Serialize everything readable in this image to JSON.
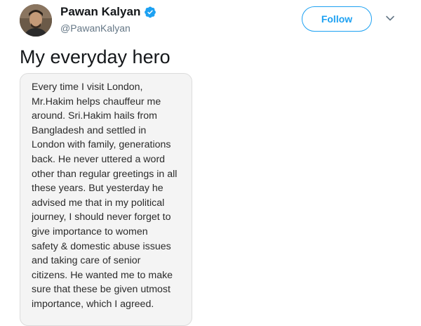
{
  "user": {
    "display_name": "Pawan Kalyan",
    "handle": "@PawanKalyan",
    "verified": true
  },
  "actions": {
    "follow_label": "Follow",
    "accent_color": "#1da1f2"
  },
  "icons": {
    "verified": "verified-badge-icon",
    "menu": "chevron-down-icon"
  },
  "tweet": {
    "text": "My everyday hero",
    "note_lines": [
      "Every time I visit London,",
      "Mr.Hakim helps chauffeur me",
      "around. Sri.Hakim hails from",
      "Bangladesh and settled in",
      "London with family, generations",
      "back. He never uttered a word",
      "other than regular greetings in all",
      "these years. But yesterday he",
      "advised me that in my political",
      "journey, I should never forget to",
      "give importance to women",
      "safety & domestic abuse issues",
      "and taking care of senior",
      "citizens. He wanted me to make",
      "sure that these be given utmost",
      "importance, which I agreed."
    ]
  }
}
